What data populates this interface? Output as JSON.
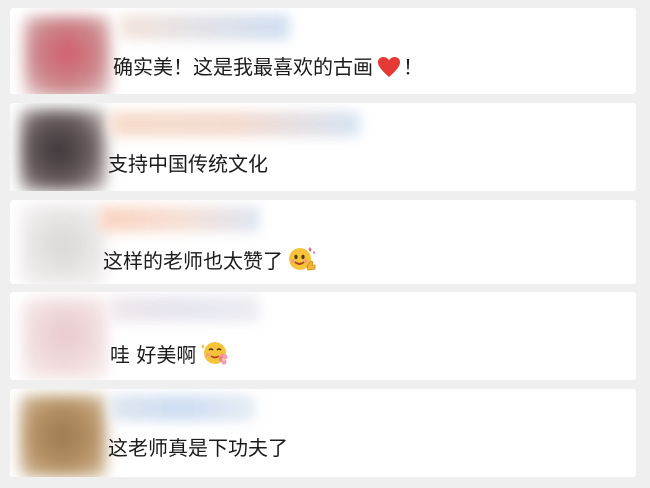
{
  "comments": [
    {
      "text": "确实美！这是我最喜欢的古画",
      "suffix": "！",
      "emoji": "red-heart-icon",
      "avatar_color": "#c9707a",
      "name_color": "#d6e2f0"
    },
    {
      "text": "支持中国传统文化",
      "suffix": "",
      "emoji": "",
      "avatar_color": "#4a4448",
      "name_color": "#f6d8c4"
    },
    {
      "text": "这样的老师也太赞了",
      "suffix": "",
      "emoji": "thumbs-up-smiley-icon",
      "avatar_color": "#e3e0df",
      "name_color": "#f8d7c6"
    },
    {
      "text": "哇 好美啊",
      "suffix": "",
      "emoji": "flower-smiley-icon",
      "avatar_color": "#f0dada",
      "name_color": "#ece8ef"
    },
    {
      "text": "这老师真是下功夫了",
      "suffix": "",
      "emoji": "",
      "avatar_color": "#a88860",
      "name_color": "#d4e0f2"
    }
  ]
}
